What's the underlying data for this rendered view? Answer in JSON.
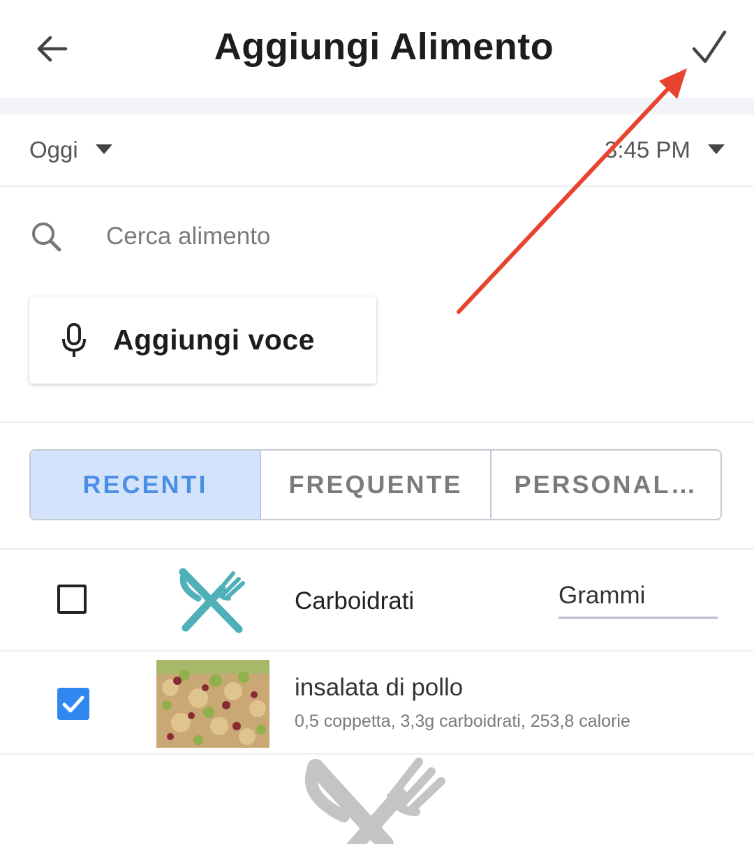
{
  "header": {
    "title": "Aggiungi Alimento",
    "back_icon": "arrow-left-icon",
    "confirm_icon": "checkmark-icon"
  },
  "datetime": {
    "date_label": "Oggi",
    "time_label": "3:45 PM",
    "caret_icon": "caret-down-icon"
  },
  "search": {
    "icon": "search-icon",
    "placeholder": "Cerca alimento",
    "value": ""
  },
  "voice": {
    "icon": "microphone-icon",
    "label": "Aggiungi voce"
  },
  "tabs": [
    {
      "label": "RECENTI",
      "active": true
    },
    {
      "label": "FREQUENTE",
      "active": false
    },
    {
      "label": "PERSONAL…",
      "active": false
    }
  ],
  "list": {
    "rows": [
      {
        "checked": false,
        "icon": "cutlery-icon",
        "title": "Carboidrati",
        "unit": "Grammi"
      },
      {
        "checked": true,
        "icon": "food-photo",
        "title": "insalata di pollo",
        "detail": "0,5 coppetta, 3,3g carboidrati, 253,8 calorie"
      }
    ]
  },
  "colors": {
    "accent": "#2e88f0",
    "tab_active_bg": "#d3e3fc",
    "tab_active_text": "#4a8fe3",
    "cutlery_teal": "#4fb0b8",
    "annotation_arrow": "#e8432e"
  }
}
